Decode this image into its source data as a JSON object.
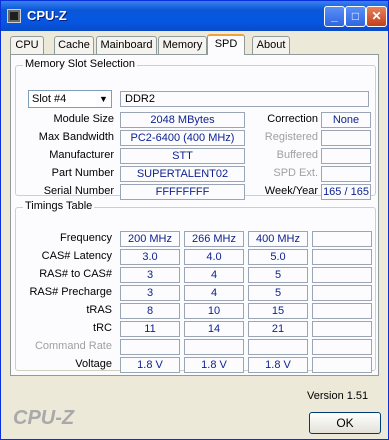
{
  "window": {
    "title": "CPU-Z"
  },
  "tabs": [
    "CPU",
    "Cache",
    "Mainboard",
    "Memory",
    "SPD",
    "About"
  ],
  "active_tab": "SPD",
  "memory_slot": {
    "group_title": "Memory Slot Selection",
    "slot_value": "Slot #4",
    "type": "DDR2",
    "module_size_label": "Module Size",
    "module_size": "2048 MBytes",
    "max_bandwidth_label": "Max Bandwidth",
    "max_bandwidth": "PC2-6400 (400 MHz)",
    "manufacturer_label": "Manufacturer",
    "manufacturer": "STT",
    "part_number_label": "Part Number",
    "part_number": "SUPERTALENT02",
    "serial_number_label": "Serial Number",
    "serial_number": "FFFFFFFF",
    "correction_label": "Correction",
    "correction": "None",
    "registered_label": "Registered",
    "registered": "",
    "buffered_label": "Buffered",
    "buffered": "",
    "spd_ext_label": "SPD Ext.",
    "spd_ext": "",
    "week_year_label": "Week/Year",
    "week_year": "165 / 165"
  },
  "timings": {
    "group_title": "Timings Table",
    "rows": [
      {
        "label": "Frequency",
        "values": [
          "200 MHz",
          "266 MHz",
          "400 MHz",
          ""
        ]
      },
      {
        "label": "CAS# Latency",
        "values": [
          "3.0",
          "4.0",
          "5.0",
          ""
        ]
      },
      {
        "label": "RAS# to CAS#",
        "values": [
          "3",
          "4",
          "5",
          ""
        ]
      },
      {
        "label": "RAS# Precharge",
        "values": [
          "3",
          "4",
          "5",
          ""
        ]
      },
      {
        "label": "tRAS",
        "values": [
          "8",
          "10",
          "15",
          ""
        ]
      },
      {
        "label": "tRC",
        "values": [
          "11",
          "14",
          "21",
          ""
        ]
      },
      {
        "label": "Command Rate",
        "values": [
          "",
          "",
          "",
          ""
        ]
      },
      {
        "label": "Voltage",
        "values": [
          "1.8 V",
          "1.8 V",
          "1.8 V",
          ""
        ]
      }
    ]
  },
  "version": "Version 1.51",
  "footer_brand": "CPU-Z",
  "ok_label": "OK"
}
